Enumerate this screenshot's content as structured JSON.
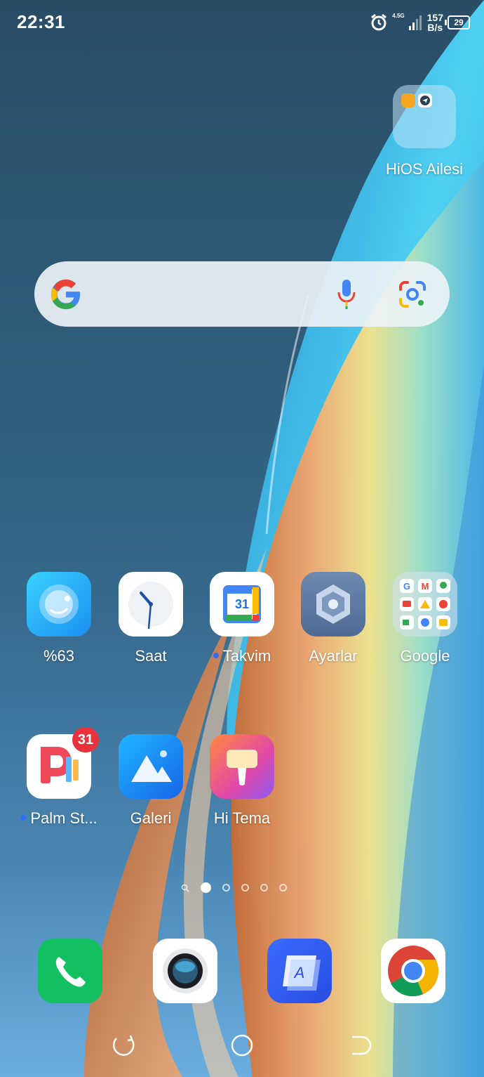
{
  "status_bar": {
    "time": "22:31",
    "network_type": "4.5G",
    "speed_value": "157",
    "speed_unit": "B/s",
    "battery_level": "29",
    "icons": [
      "alarm-icon",
      "signal-icon",
      "battery-icon"
    ]
  },
  "folder_hios": {
    "label": "HiOS Ailesi"
  },
  "search_widget": {
    "icons": [
      "google-g-icon",
      "mic-icon",
      "google-lens-icon"
    ]
  },
  "apps_row1": [
    {
      "label": "%63",
      "icon": "phone-master-icon"
    },
    {
      "label": "Saat",
      "icon": "clock-icon"
    },
    {
      "label": "Takvim",
      "icon": "calendar-icon",
      "calendar_day": "31",
      "new_dot": true
    },
    {
      "label": "Ayarlar",
      "icon": "settings-icon"
    },
    {
      "label": "Google",
      "icon": "google-folder-icon"
    }
  ],
  "apps_row2": [
    {
      "label": "Palm St...",
      "icon": "palm-store-icon",
      "badge": "31",
      "new_dot": true
    },
    {
      "label": "Galeri",
      "icon": "gallery-icon"
    },
    {
      "label": "Hi Tema",
      "icon": "theme-icon"
    }
  ],
  "pager": {
    "pages": 5,
    "active_page": 1
  },
  "dock": [
    "phone-icon",
    "camera-icon",
    "ai-assistant-icon",
    "chrome-icon"
  ],
  "navigation": [
    "recent-apps-icon",
    "home-icon",
    "back-icon"
  ],
  "colors": {
    "badge": "#e8323c",
    "new_dot": "#2f6bff"
  }
}
